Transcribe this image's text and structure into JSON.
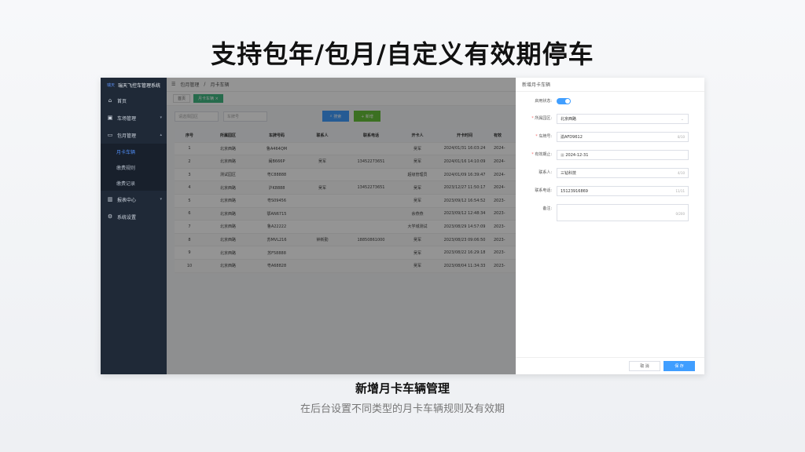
{
  "headline": "支持包年/包月/自定义有效期停车",
  "sidebar": {
    "brand": "瑞天飞控车管理系统",
    "brand_logo": "瑞天",
    "items": [
      {
        "label": "首页",
        "icon": "home-icon"
      },
      {
        "label": "车场管理",
        "icon": "parking-icon"
      },
      {
        "label": "包月管理",
        "icon": "card-icon"
      }
    ],
    "subitems": [
      {
        "label": "月卡车辆",
        "active": true
      },
      {
        "label": "缴费规则",
        "active": false
      },
      {
        "label": "缴费记录",
        "active": false
      }
    ],
    "items2": [
      {
        "label": "报表中心",
        "icon": "chart-icon"
      },
      {
        "label": "系统设置",
        "icon": "gear-icon"
      }
    ]
  },
  "topbar": {
    "breadcrumb1": "包月管理",
    "separator": "/",
    "breadcrumb2": "月卡车辆"
  },
  "tabs": [
    {
      "label": "首页"
    },
    {
      "label": "月卡车辆"
    }
  ],
  "filters": {
    "lot_placeholder": "请选择园区",
    "plate_placeholder": "车牌号",
    "search_label": "搜索",
    "add_label": "+ 新增"
  },
  "table": {
    "headers": [
      "序号",
      "所属园区",
      "车牌号码",
      "联系人",
      "联系电话",
      "开卡人",
      "开卡时间",
      "有效"
    ],
    "rows": [
      [
        "1",
        "北京西路",
        "鲁A464QM",
        "",
        "",
        "吴军",
        "2024/01/31 16:03:24",
        "2024-"
      ],
      [
        "2",
        "北京西路",
        "闽B666P",
        "吴军",
        "13452273651",
        "吴军",
        "2024/01/16 14:10:09",
        "2024-"
      ],
      [
        "3",
        "测试园区",
        "粤C88888",
        "",
        "",
        "超级管理员",
        "2024/01/09 16:39:47",
        "2024-"
      ],
      [
        "4",
        "北京西路",
        "沪K8888",
        "吴军",
        "13452273651",
        "吴军",
        "2023/12/27 11:50:17",
        "2024-"
      ],
      [
        "5",
        "北京西路",
        "粤S09456",
        "",
        "",
        "吴军",
        "2023/09/12 16:54:52",
        "2023-"
      ],
      [
        "6",
        "北京西路",
        "鄂AN6715",
        "",
        "",
        "余燕燕",
        "2023/09/12 12:48:34",
        "2023-"
      ],
      [
        "7",
        "北京西路",
        "鲁A22222",
        "",
        "",
        "大学城测试",
        "2023/08/29 14:57:09",
        "2023-"
      ],
      [
        "8",
        "北京西路",
        "苏MVL216",
        "钟新勤",
        "18850861000",
        "吴军",
        "2023/08/23 09:06:50",
        "2023-"
      ],
      [
        "9",
        "北京西路",
        "苏F58888",
        "",
        "",
        "吴军",
        "2023/08/22 16:29:18",
        "2023-"
      ],
      [
        "10",
        "北京西路",
        "粤A68828",
        "",
        "",
        "吴军",
        "2023/08/04 11:34:33",
        "2023-"
      ]
    ]
  },
  "drawer": {
    "title": "新增月卡车辆",
    "enabled_label": "启用状态:",
    "enabled": true,
    "lot_label": "所属园区:",
    "lot_value": "北京西路",
    "plate_label": "车牌号:",
    "plate_value": "渝AFD9612",
    "plate_count": "8/10",
    "expire_label": "有效期止:",
    "expire_value": "2024-12-31",
    "contact_label": "联系人:",
    "contact_value": "三钻科技",
    "contact_count": "4/10",
    "phone_label": "联系电话:",
    "phone_value": "15123916869",
    "phone_count": "11/11",
    "note_label": "备注:",
    "note_count": "0/200",
    "cancel_label": "取 消",
    "save_label": "保 存"
  },
  "caption": {
    "title": "新增月卡车辆管理",
    "subtitle": "在后台设置不同类型的月卡车辆规则及有效期"
  }
}
